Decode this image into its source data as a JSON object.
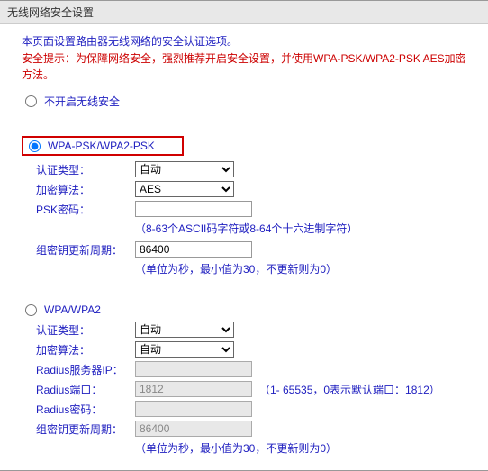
{
  "title": "无线网络安全设置",
  "intro": "本页面设置路由器无线网络的安全认证选项。",
  "warning": "安全提示：为保障网络安全，强烈推荐开启安全设置，并使用WPA-PSK/WPA2-PSK AES加密方法。",
  "radio_disable_label": "不开启无线安全",
  "section1": {
    "radio_label": "WPA-PSK/WPA2-PSK",
    "auth_label": "认证类型：",
    "auth_value": "自动",
    "enc_label": "加密算法：",
    "enc_value": "AES",
    "psk_label": "PSK密码：",
    "psk_value": "",
    "psk_hint": "（8-63个ASCII码字符或8-64个十六进制字符）",
    "rekey_label": "组密钥更新周期：",
    "rekey_value": "86400",
    "rekey_hint": "（单位为秒，最小值为30，不更新则为0）"
  },
  "section2": {
    "radio_label": "WPA/WPA2",
    "auth_label": "认证类型：",
    "auth_value": "自动",
    "enc_label": "加密算法：",
    "enc_value": "自动",
    "radius_ip_label": "Radius服务器IP：",
    "radius_ip_value": "",
    "radius_port_label": "Radius端口：",
    "radius_port_value": "1812",
    "radius_port_note": "（1- 65535，0表示默认端口：1812）",
    "radius_pwd_label": "Radius密码：",
    "radius_pwd_value": "",
    "rekey_label": "组密钥更新周期：",
    "rekey_value": "86400",
    "rekey_hint": "（单位为秒，最小值为30，不更新则为0）"
  }
}
